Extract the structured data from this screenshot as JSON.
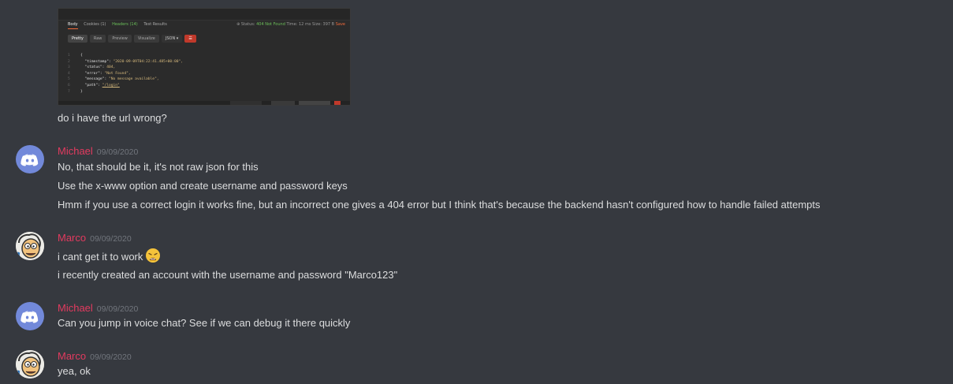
{
  "attachment": {
    "tabs": [
      "Body",
      "Cookies (1)",
      "Headers (14)",
      "Test Results"
    ],
    "status": {
      "label": "Status:",
      "value": "404 Not Found",
      "time": "Time: 12 ms",
      "size": "Size: 397 B",
      "save": "Save"
    },
    "view_buttons": [
      "Pretty",
      "Raw",
      "Preview",
      "Visualize"
    ],
    "format": "JSON ▾",
    "code": [
      {
        "n": "1",
        "text": "{"
      },
      {
        "n": "2",
        "key": "\"timestamp\": ",
        "val": "\"2020-09-09T04:22:41.485+00:00\","
      },
      {
        "n": "3",
        "key": "\"status\": ",
        "val": "404,"
      },
      {
        "n": "4",
        "key": "\"error\": ",
        "val": "\"Not Found\","
      },
      {
        "n": "5",
        "key": "\"message\": ",
        "val": "\"No message available\","
      },
      {
        "n": "6",
        "key": "\"path\": ",
        "val": "\"/login\""
      },
      {
        "n": "7",
        "text": "}"
      }
    ]
  },
  "messages": [
    {
      "text": "do i have the url wrong?"
    },
    {
      "author": "Michael",
      "timestamp": "09/09/2020",
      "avatar": "discord-avatar-icon",
      "lines": [
        "No, that should be it, it's not raw json for this",
        "Use the x-www option and create username and password keys",
        "Hmm if you use a correct login it works fine, but an incorrect one gives a 404 error but I think that's because the backend hasn't configured how to handle failed attempts"
      ]
    },
    {
      "author": "Marco",
      "timestamp": "09/09/2020",
      "avatar": "cartoon-face-avatar",
      "lines": [
        "i cant get it to work",
        "i recently created an account with the username and password \"Marco123\""
      ],
      "emoji": "weary-face-emoji"
    },
    {
      "author": "Michael",
      "timestamp": "09/09/2020",
      "avatar": "discord-avatar-icon",
      "lines": [
        "Can you jump in voice chat? See if we can debug it there quickly"
      ]
    },
    {
      "author": "Marco",
      "timestamp": "09/09/2020",
      "avatar": "cartoon-face-avatar",
      "lines": [
        "yea, ok"
      ]
    }
  ],
  "colors": {
    "background": "#36393f",
    "text": "#dcddde",
    "author": "#e23a5f",
    "timestamp": "#72767d",
    "discord_blurple": "#7289da"
  }
}
